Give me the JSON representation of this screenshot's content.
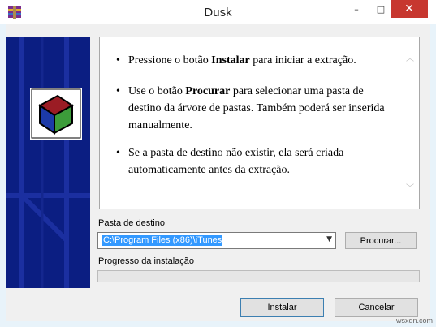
{
  "window": {
    "title": "Dusk"
  },
  "title_buttons": {
    "minimize": "–",
    "maximize": "□",
    "close": "✕"
  },
  "info": {
    "items": [
      {
        "pre": "Pressione o botão ",
        "bold": "Instalar",
        "post": " para iniciar a extração."
      },
      {
        "pre": "Use o botão ",
        "bold": "Procurar",
        "post": " para selecionar uma pasta de destino da árvore de pastas. Também poderá ser inserida manualmente."
      },
      {
        "pre": "",
        "bold": "",
        "post": "Se a pasta de destino não existir, ela será criada automaticamente antes da extração."
      }
    ],
    "bullet": "•",
    "scroll_up": "︿",
    "scroll_down": "﹀"
  },
  "destination": {
    "label": "Pasta de destino",
    "value": "C:\\Program Files (x86)\\iTunes",
    "arrow": "▼",
    "browse_label": "Procurar..."
  },
  "progress": {
    "label": "Progresso da instalação",
    "value": 0
  },
  "footer": {
    "install_label": "Instalar",
    "cancel_label": "Cancelar"
  },
  "watermark": "wsxdn.com",
  "colors": {
    "side_panel": "#0b1e82",
    "accent": "#3399ff",
    "close": "#c7372f"
  }
}
